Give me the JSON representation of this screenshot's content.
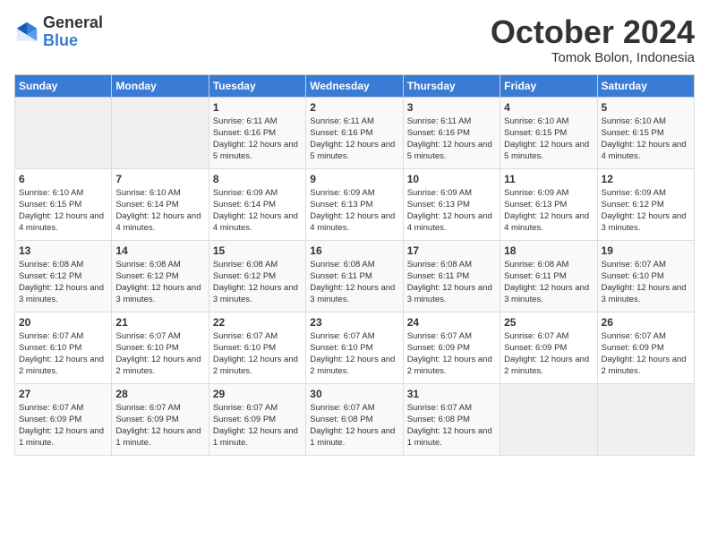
{
  "header": {
    "logo": {
      "general": "General",
      "blue": "Blue"
    },
    "title": "October 2024",
    "subtitle": "Tomok Bolon, Indonesia"
  },
  "weekdays": [
    "Sunday",
    "Monday",
    "Tuesday",
    "Wednesday",
    "Thursday",
    "Friday",
    "Saturday"
  ],
  "weeks": [
    [
      {
        "day": "",
        "sunrise": "",
        "sunset": "",
        "daylight": ""
      },
      {
        "day": "",
        "sunrise": "",
        "sunset": "",
        "daylight": ""
      },
      {
        "day": "1",
        "sunrise": "Sunrise: 6:11 AM",
        "sunset": "Sunset: 6:16 PM",
        "daylight": "Daylight: 12 hours and 5 minutes."
      },
      {
        "day": "2",
        "sunrise": "Sunrise: 6:11 AM",
        "sunset": "Sunset: 6:16 PM",
        "daylight": "Daylight: 12 hours and 5 minutes."
      },
      {
        "day": "3",
        "sunrise": "Sunrise: 6:11 AM",
        "sunset": "Sunset: 6:16 PM",
        "daylight": "Daylight: 12 hours and 5 minutes."
      },
      {
        "day": "4",
        "sunrise": "Sunrise: 6:10 AM",
        "sunset": "Sunset: 6:15 PM",
        "daylight": "Daylight: 12 hours and 5 minutes."
      },
      {
        "day": "5",
        "sunrise": "Sunrise: 6:10 AM",
        "sunset": "Sunset: 6:15 PM",
        "daylight": "Daylight: 12 hours and 4 minutes."
      }
    ],
    [
      {
        "day": "6",
        "sunrise": "Sunrise: 6:10 AM",
        "sunset": "Sunset: 6:15 PM",
        "daylight": "Daylight: 12 hours and 4 minutes."
      },
      {
        "day": "7",
        "sunrise": "Sunrise: 6:10 AM",
        "sunset": "Sunset: 6:14 PM",
        "daylight": "Daylight: 12 hours and 4 minutes."
      },
      {
        "day": "8",
        "sunrise": "Sunrise: 6:09 AM",
        "sunset": "Sunset: 6:14 PM",
        "daylight": "Daylight: 12 hours and 4 minutes."
      },
      {
        "day": "9",
        "sunrise": "Sunrise: 6:09 AM",
        "sunset": "Sunset: 6:13 PM",
        "daylight": "Daylight: 12 hours and 4 minutes."
      },
      {
        "day": "10",
        "sunrise": "Sunrise: 6:09 AM",
        "sunset": "Sunset: 6:13 PM",
        "daylight": "Daylight: 12 hours and 4 minutes."
      },
      {
        "day": "11",
        "sunrise": "Sunrise: 6:09 AM",
        "sunset": "Sunset: 6:13 PM",
        "daylight": "Daylight: 12 hours and 4 minutes."
      },
      {
        "day": "12",
        "sunrise": "Sunrise: 6:09 AM",
        "sunset": "Sunset: 6:12 PM",
        "daylight": "Daylight: 12 hours and 3 minutes."
      }
    ],
    [
      {
        "day": "13",
        "sunrise": "Sunrise: 6:08 AM",
        "sunset": "Sunset: 6:12 PM",
        "daylight": "Daylight: 12 hours and 3 minutes."
      },
      {
        "day": "14",
        "sunrise": "Sunrise: 6:08 AM",
        "sunset": "Sunset: 6:12 PM",
        "daylight": "Daylight: 12 hours and 3 minutes."
      },
      {
        "day": "15",
        "sunrise": "Sunrise: 6:08 AM",
        "sunset": "Sunset: 6:12 PM",
        "daylight": "Daylight: 12 hours and 3 minutes."
      },
      {
        "day": "16",
        "sunrise": "Sunrise: 6:08 AM",
        "sunset": "Sunset: 6:11 PM",
        "daylight": "Daylight: 12 hours and 3 minutes."
      },
      {
        "day": "17",
        "sunrise": "Sunrise: 6:08 AM",
        "sunset": "Sunset: 6:11 PM",
        "daylight": "Daylight: 12 hours and 3 minutes."
      },
      {
        "day": "18",
        "sunrise": "Sunrise: 6:08 AM",
        "sunset": "Sunset: 6:11 PM",
        "daylight": "Daylight: 12 hours and 3 minutes."
      },
      {
        "day": "19",
        "sunrise": "Sunrise: 6:07 AM",
        "sunset": "Sunset: 6:10 PM",
        "daylight": "Daylight: 12 hours and 3 minutes."
      }
    ],
    [
      {
        "day": "20",
        "sunrise": "Sunrise: 6:07 AM",
        "sunset": "Sunset: 6:10 PM",
        "daylight": "Daylight: 12 hours and 2 minutes."
      },
      {
        "day": "21",
        "sunrise": "Sunrise: 6:07 AM",
        "sunset": "Sunset: 6:10 PM",
        "daylight": "Daylight: 12 hours and 2 minutes."
      },
      {
        "day": "22",
        "sunrise": "Sunrise: 6:07 AM",
        "sunset": "Sunset: 6:10 PM",
        "daylight": "Daylight: 12 hours and 2 minutes."
      },
      {
        "day": "23",
        "sunrise": "Sunrise: 6:07 AM",
        "sunset": "Sunset: 6:10 PM",
        "daylight": "Daylight: 12 hours and 2 minutes."
      },
      {
        "day": "24",
        "sunrise": "Sunrise: 6:07 AM",
        "sunset": "Sunset: 6:09 PM",
        "daylight": "Daylight: 12 hours and 2 minutes."
      },
      {
        "day": "25",
        "sunrise": "Sunrise: 6:07 AM",
        "sunset": "Sunset: 6:09 PM",
        "daylight": "Daylight: 12 hours and 2 minutes."
      },
      {
        "day": "26",
        "sunrise": "Sunrise: 6:07 AM",
        "sunset": "Sunset: 6:09 PM",
        "daylight": "Daylight: 12 hours and 2 minutes."
      }
    ],
    [
      {
        "day": "27",
        "sunrise": "Sunrise: 6:07 AM",
        "sunset": "Sunset: 6:09 PM",
        "daylight": "Daylight: 12 hours and 1 minute."
      },
      {
        "day": "28",
        "sunrise": "Sunrise: 6:07 AM",
        "sunset": "Sunset: 6:09 PM",
        "daylight": "Daylight: 12 hours and 1 minute."
      },
      {
        "day": "29",
        "sunrise": "Sunrise: 6:07 AM",
        "sunset": "Sunset: 6:09 PM",
        "daylight": "Daylight: 12 hours and 1 minute."
      },
      {
        "day": "30",
        "sunrise": "Sunrise: 6:07 AM",
        "sunset": "Sunset: 6:08 PM",
        "daylight": "Daylight: 12 hours and 1 minute."
      },
      {
        "day": "31",
        "sunrise": "Sunrise: 6:07 AM",
        "sunset": "Sunset: 6:08 PM",
        "daylight": "Daylight: 12 hours and 1 minute."
      },
      {
        "day": "",
        "sunrise": "",
        "sunset": "",
        "daylight": ""
      },
      {
        "day": "",
        "sunrise": "",
        "sunset": "",
        "daylight": ""
      }
    ]
  ]
}
